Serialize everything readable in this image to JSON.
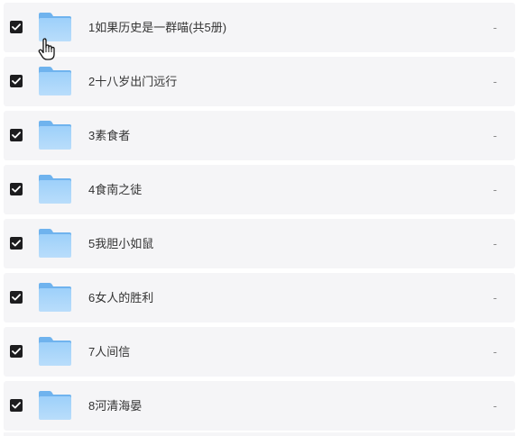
{
  "colors": {
    "row_background": "#f5f5f7",
    "checkbox": "#1d1d1f",
    "folder": "#8ec5f5"
  },
  "files": [
    {
      "name": "1如果历史是一群喵(共5册)",
      "size": "-",
      "checked": true,
      "icon": "folder-icon"
    },
    {
      "name": "2十八岁出门远行",
      "size": "-",
      "checked": true,
      "icon": "folder-icon"
    },
    {
      "name": "3素食者",
      "size": "-",
      "checked": true,
      "icon": "folder-icon"
    },
    {
      "name": "4食南之徒",
      "size": "-",
      "checked": true,
      "icon": "folder-icon"
    },
    {
      "name": "5我胆小如鼠",
      "size": "-",
      "checked": true,
      "icon": "folder-icon"
    },
    {
      "name": "6女人的胜利",
      "size": "-",
      "checked": true,
      "icon": "folder-icon"
    },
    {
      "name": "7人间信",
      "size": "-",
      "checked": true,
      "icon": "folder-icon"
    },
    {
      "name": "8河清海晏",
      "size": "-",
      "checked": true,
      "icon": "folder-icon"
    }
  ],
  "cursor": "hand-pointer-icon"
}
